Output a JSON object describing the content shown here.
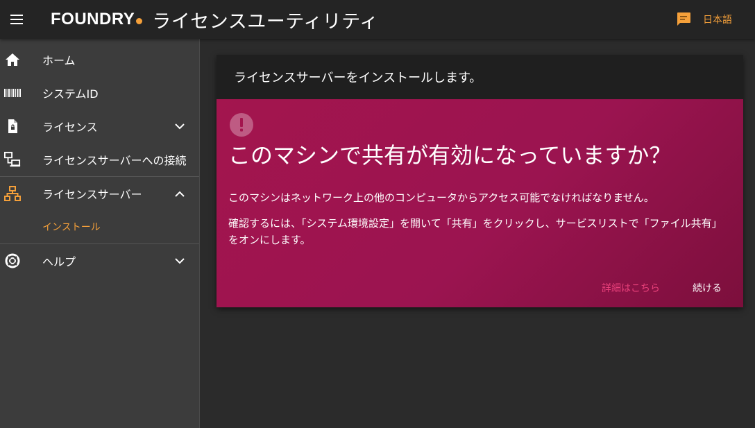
{
  "topbar": {
    "logo_text": "FOUNDRY",
    "title": "ライセンスユーティリティ",
    "language": "日本語",
    "menu_icon": "menu-icon",
    "chat_icon": "chat-bubble-icon",
    "accent_color": "#f5a03a"
  },
  "sidebar": {
    "items": [
      {
        "label": "ホーム",
        "icon": "home-icon"
      },
      {
        "label": "システムID",
        "icon": "barcode-icon"
      },
      {
        "label": "ライセンス",
        "icon": "license-file-icon",
        "expandable": true,
        "expanded": false
      },
      {
        "label": "ライセンスサーバーへの接続",
        "icon": "server-connect-icon"
      },
      {
        "label": "ライセンスサーバー",
        "icon": "network-icon",
        "expandable": true,
        "expanded": true,
        "children": [
          {
            "label": "インストール",
            "active": true
          }
        ]
      },
      {
        "label": "ヘルプ",
        "icon": "lifebuoy-icon",
        "expandable": true,
        "expanded": false
      }
    ]
  },
  "main": {
    "header": "ライセンスサーバーをインストールします。",
    "card": {
      "icon": "warning-icon",
      "title": "このマシンで共有が有効になっていますか？",
      "paragraph1": "このマシンはネットワーク上の他のコンピュータからアクセス可能でなければなりません。",
      "paragraph2": "確認するには、「システム環境設定」を開いて「共有」をクリックし、サービスリストで「ファイル共有」をオンにします。",
      "more_button": "詳細はこちら",
      "continue_button": "続ける",
      "background_color": "#a3154e"
    }
  }
}
